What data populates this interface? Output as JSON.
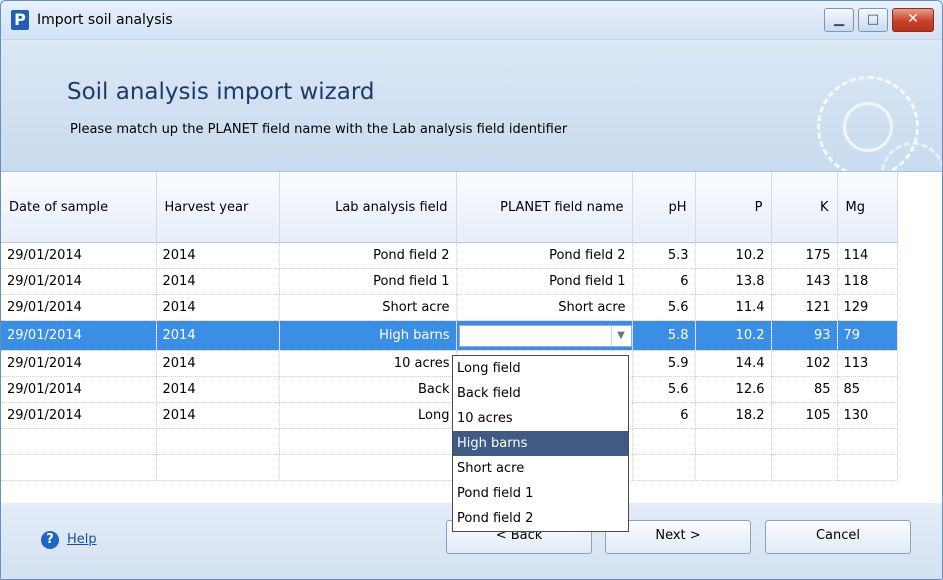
{
  "window": {
    "title": "Import soil analysis",
    "app_icon": "P"
  },
  "header": {
    "heading": "Soil analysis import wizard",
    "subheading": "Please match up the PLANET field name with the Lab analysis field identifier"
  },
  "grid": {
    "columns": [
      "Date of sample",
      "Harvest year",
      "Lab analysis field",
      "PLANET field name",
      "pH",
      "P",
      "K",
      "Mg"
    ],
    "rows": [
      [
        "29/01/2014",
        "2014",
        "Pond field 2",
        "Pond field 2",
        "5.3",
        "10.2",
        "175",
        "114"
      ],
      [
        "29/01/2014",
        "2014",
        "Pond field 1",
        "Pond field 1",
        "6",
        "13.8",
        "143",
        "118"
      ],
      [
        "29/01/2014",
        "2014",
        "Short acre",
        "Short acre",
        "5.6",
        "11.4",
        "121",
        "129"
      ],
      [
        "29/01/2014",
        "2014",
        "High barns",
        "",
        "5.8",
        "10.2",
        "93",
        "79"
      ],
      [
        "29/01/2014",
        "2014",
        "10 acres",
        "",
        "5.9",
        "14.4",
        "102",
        "113"
      ],
      [
        "29/01/2014",
        "2014",
        "Back",
        "",
        "5.6",
        "12.6",
        "85",
        "85"
      ],
      [
        "29/01/2014",
        "2014",
        "Long",
        "",
        "6",
        "18.2",
        "105",
        "130"
      ]
    ]
  },
  "dropdown": {
    "options": [
      "Long field",
      "Back field",
      "10 acres",
      "High barns",
      "Short acre",
      "Pond field 1",
      "Pond field 2"
    ],
    "highlighted": "High barns"
  },
  "footer": {
    "help_label": "Help",
    "back_label": "< Back",
    "next_label": "Next >",
    "cancel_label": "Cancel"
  }
}
